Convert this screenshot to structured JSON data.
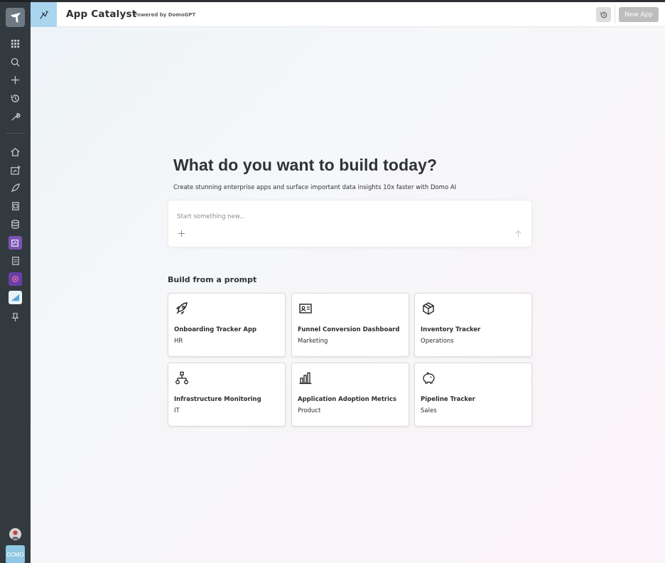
{
  "header": {
    "title": "App Catalyst",
    "subtitle": "Powered by DomoGPT",
    "new_app_label": "New App"
  },
  "hero": {
    "title": "What do you want to build today?",
    "subtitle": "Create stunning enterprise apps and surface important data insights 10x faster with Domo AI"
  },
  "prompt": {
    "placeholder": "Start something new..."
  },
  "section": {
    "title": "Build from a prompt"
  },
  "cards": [
    {
      "title": "Onboarding Tracker App",
      "category": "HR",
      "icon": "rocket-icon"
    },
    {
      "title": "Funnel Conversion Dashboard",
      "category": "Marketing",
      "icon": "id-card-icon"
    },
    {
      "title": "Inventory Tracker",
      "category": "Operations",
      "icon": "box-icon"
    },
    {
      "title": "Infrastructure Monitoring",
      "category": "IT",
      "icon": "network-icon"
    },
    {
      "title": "Application Adoption Metrics",
      "category": "Product",
      "icon": "bar-chart-icon"
    },
    {
      "title": "Pipeline Tracker",
      "category": "Sales",
      "icon": "piggy-bank-icon"
    }
  ],
  "sidebar": {
    "badge_label": "DOMO"
  },
  "colors": {
    "sidebar": "#323a40",
    "header_icon_bg": "#a9d5ef",
    "button_disabled": "#bdbdbd"
  }
}
